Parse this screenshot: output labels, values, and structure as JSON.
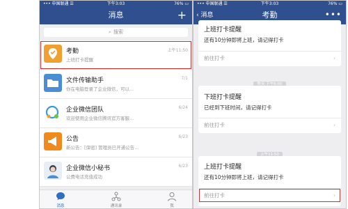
{
  "left": {
    "status": {
      "carrier": "••• 中国联通 ☰",
      "time": "下午3:03",
      "battery": "76% ▭"
    },
    "nav": {
      "title": "消息",
      "plus": "+"
    },
    "search": {
      "icon": "⌕",
      "placeholder": "搜索"
    },
    "conversations": [
      {
        "name": "考勤",
        "preview": "上班打卡提醒",
        "time": "上午11:50",
        "icon": "attendance-icon",
        "color": "#f0a030",
        "highlight": true
      },
      {
        "name": "文件传输助手",
        "preview": "你在电脑登录了企业微信，可以...",
        "time": "7/1",
        "icon": "folder-icon",
        "color": "#4a8fd4"
      },
      {
        "name": "企业微信团队",
        "preview": "欢迎使用企业微信腾讯官方客服...",
        "time": "6/24",
        "icon": "team-chat-icon",
        "color": "#3a9ad8"
      },
      {
        "name": "公告",
        "preview": "新公告：[保密] 管理员已开通公告...",
        "time": "6/23",
        "icon": "megaphone-icon",
        "color": "#f08a1c"
      },
      {
        "name": "企业微信小秘书",
        "preview": "公费电话充值成功",
        "time": "6/23",
        "icon": "secretary-icon",
        "color": "#e8eef6"
      }
    ],
    "tabs": [
      {
        "label": "消息",
        "icon": "message-icon"
      },
      {
        "label": "通讯录",
        "icon": "contacts-icon"
      },
      {
        "label": "我",
        "icon": "profile-icon"
      }
    ]
  },
  "right": {
    "status": {
      "carrier": "••• 中国联通 ☰",
      "time": "下午3:03",
      "battery": "76% ▭"
    },
    "nav": {
      "back": "‹ 消息",
      "title": "考勤",
      "more": "•••"
    },
    "cards": [
      {
        "title": "上班打卡提醒",
        "body": "还有10分钟即将上班，请记得打卡",
        "action": "前往打卡"
      },
      {
        "title": "下班打卡提醒",
        "body": "已经到下班时间，请记得打卡",
        "action": "前往打卡"
      },
      {
        "title": "上班打卡提醒",
        "body": "还有10分钟即将上班，请记得打卡",
        "action": "前往打卡"
      }
    ],
    "timestamps": [
      "昨天 下午6:00",
      "上午11:50"
    ],
    "arrow": "›"
  }
}
